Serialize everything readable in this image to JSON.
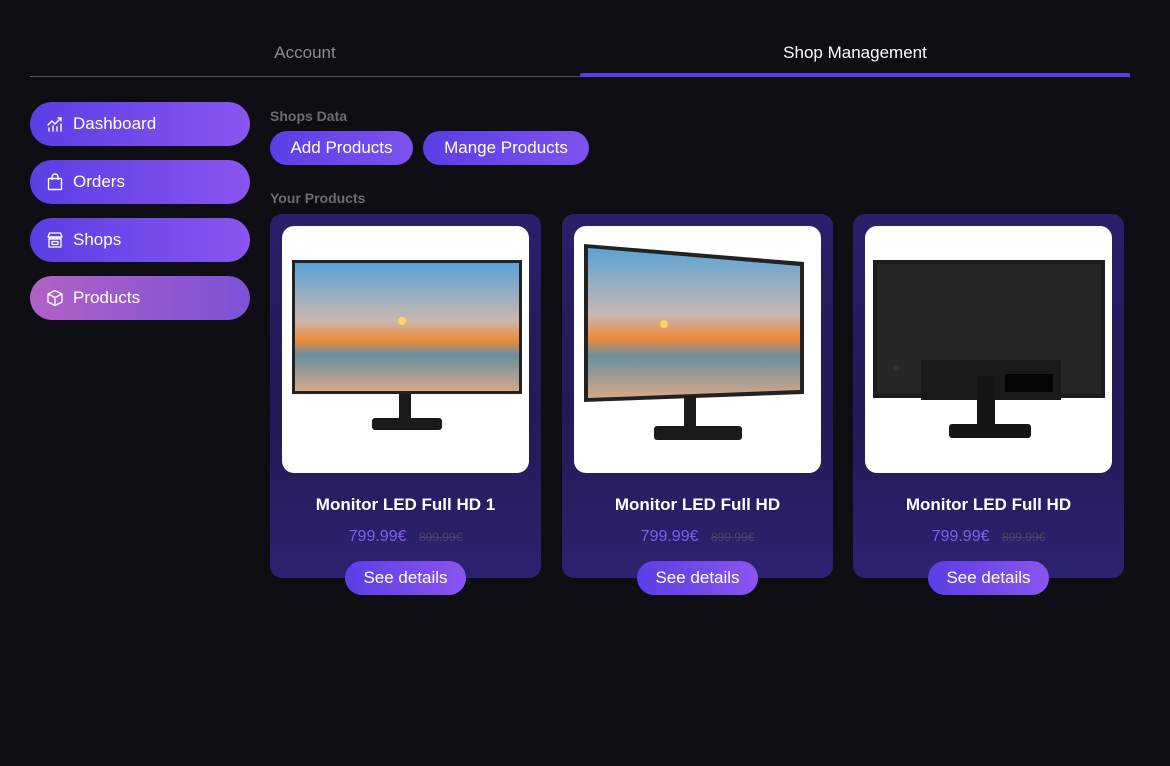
{
  "tabs": [
    {
      "label": "Account"
    },
    {
      "label": "Shop Management"
    }
  ],
  "sidebar": {
    "items": [
      {
        "label": "Dashboard",
        "icon": "chart-icon"
      },
      {
        "label": "Orders",
        "icon": "shopping-bag-icon"
      },
      {
        "label": "Shops",
        "icon": "store-icon"
      },
      {
        "label": "Products",
        "icon": "box-icon"
      }
    ],
    "active": "Products"
  },
  "main": {
    "shops_data_title": "Shops Data",
    "add_products_label": "Add Products",
    "manage_products_label": "Mange Products",
    "your_products_title": "Your Products"
  },
  "products": [
    {
      "title": "Monitor LED Full HD 1",
      "price": "799.99€",
      "old_price": "899.99€",
      "button": "See details",
      "image": "monitor-front"
    },
    {
      "title": "Monitor LED Full HD",
      "price": "799.99€",
      "old_price": "899.99€",
      "button": "See details",
      "image": "monitor-angled"
    },
    {
      "title": "Monitor LED Full HD",
      "price": "799.99€",
      "old_price": "899.99€",
      "button": "See details",
      "image": "monitor-back"
    }
  ],
  "colors": {
    "background": "#100e15",
    "accent": "#5b3ee6",
    "card": "#2a1f6a",
    "price": "#7f5cf0"
  }
}
